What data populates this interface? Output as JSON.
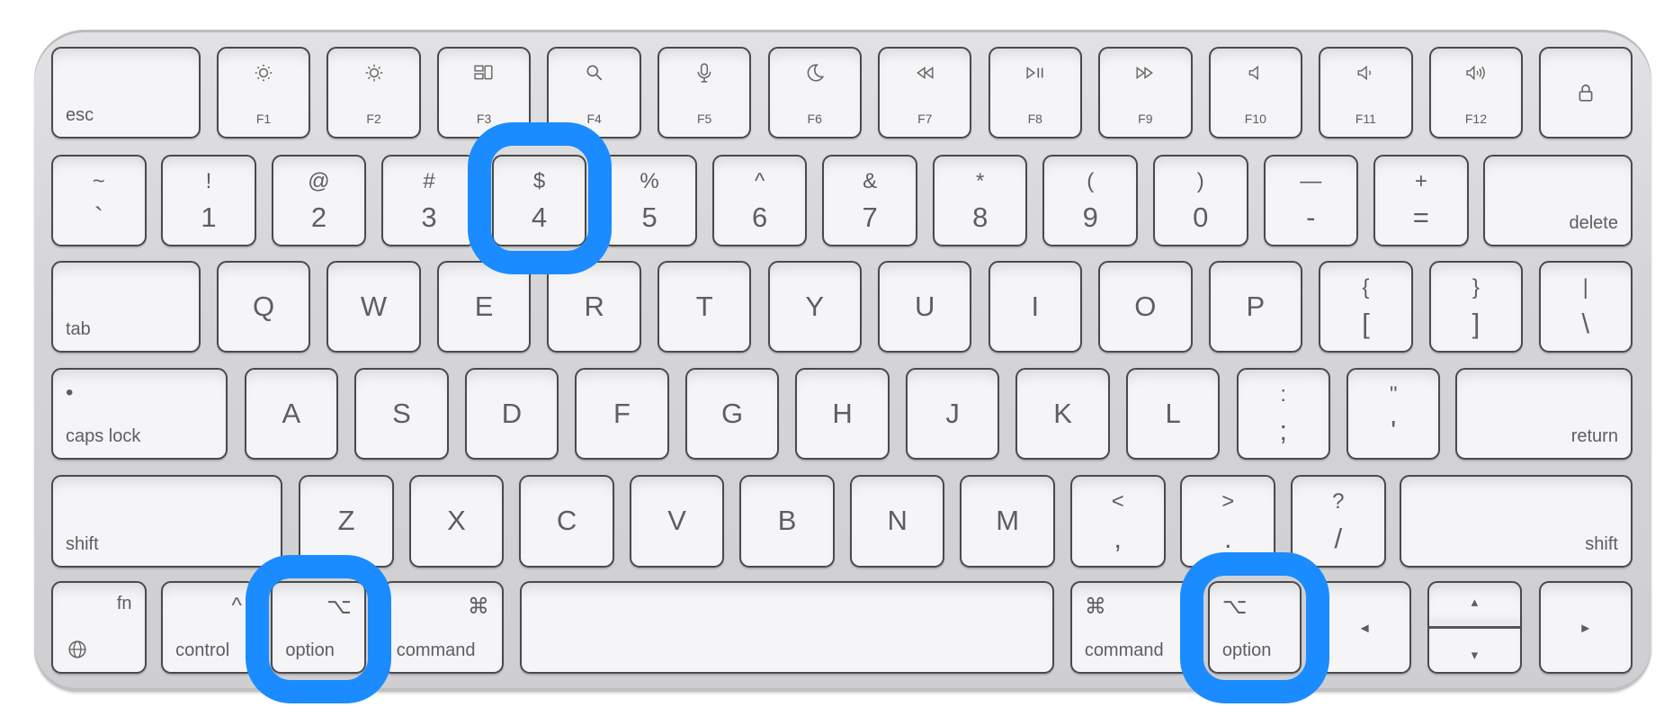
{
  "highlight_color": "#1a8cff",
  "highlighted_keys": [
    "4",
    "option (left)",
    "option (right)"
  ],
  "rows": [
    {
      "keys": [
        {
          "bl": "esc"
        },
        {
          "icon": "brightness-down-icon",
          "fn": "F1"
        },
        {
          "icon": "brightness-up-icon",
          "fn": "F2"
        },
        {
          "icon": "mission-control-icon",
          "fn": "F3"
        },
        {
          "icon": "search-icon",
          "fn": "F4"
        },
        {
          "icon": "microphone-icon",
          "fn": "F5"
        },
        {
          "icon": "moon-icon",
          "fn": "F6"
        },
        {
          "icon": "rewind-icon",
          "fn": "F7"
        },
        {
          "icon": "play-pause-icon",
          "fn": "F8"
        },
        {
          "icon": "fast-forward-icon",
          "fn": "F9"
        },
        {
          "icon": "mute-icon",
          "fn": "F10"
        },
        {
          "icon": "volume-down-icon",
          "fn": "F11"
        },
        {
          "icon": "volume-up-icon",
          "fn": "F12"
        },
        {
          "icon": "lock-icon"
        }
      ]
    },
    {
      "keys": [
        {
          "top": "~",
          "bottom": "`"
        },
        {
          "top": "!",
          "bottom": "1"
        },
        {
          "top": "@",
          "bottom": "2"
        },
        {
          "top": "#",
          "bottom": "3"
        },
        {
          "top": "$",
          "bottom": "4"
        },
        {
          "top": "%",
          "bottom": "5"
        },
        {
          "top": "^",
          "bottom": "6"
        },
        {
          "top": "&",
          "bottom": "7"
        },
        {
          "top": "*",
          "bottom": "8"
        },
        {
          "top": "(",
          "bottom": "9"
        },
        {
          "top": ")",
          "bottom": "0"
        },
        {
          "top": "—",
          "bottom": "-"
        },
        {
          "top": "+",
          "bottom": "="
        },
        {
          "br": "delete"
        }
      ]
    },
    {
      "keys": [
        {
          "bl": "tab"
        },
        {
          "c": "Q"
        },
        {
          "c": "W"
        },
        {
          "c": "E"
        },
        {
          "c": "R"
        },
        {
          "c": "T"
        },
        {
          "c": "Y"
        },
        {
          "c": "U"
        },
        {
          "c": "I"
        },
        {
          "c": "O"
        },
        {
          "c": "P"
        },
        {
          "top": "{",
          "bottom": "["
        },
        {
          "top": "}",
          "bottom": "]"
        },
        {
          "top": "|",
          "bottom": "\\"
        }
      ]
    },
    {
      "keys": [
        {
          "tl": "•",
          "bl": "caps lock"
        },
        {
          "c": "A"
        },
        {
          "c": "S"
        },
        {
          "c": "D"
        },
        {
          "c": "F"
        },
        {
          "c": "G"
        },
        {
          "c": "H"
        },
        {
          "c": "J"
        },
        {
          "c": "K"
        },
        {
          "c": "L"
        },
        {
          "top": ":",
          "bottom": ";"
        },
        {
          "top": "\"",
          "bottom": "'"
        },
        {
          "br": "return"
        }
      ]
    },
    {
      "keys": [
        {
          "bl": "shift"
        },
        {
          "c": "Z"
        },
        {
          "c": "X"
        },
        {
          "c": "C"
        },
        {
          "c": "V"
        },
        {
          "c": "B"
        },
        {
          "c": "N"
        },
        {
          "c": "M"
        },
        {
          "top": "<",
          "bottom": ","
        },
        {
          "top": ">",
          "bottom": "."
        },
        {
          "top": "?",
          "bottom": "/"
        },
        {
          "br": "shift"
        }
      ]
    },
    {
      "keys": [
        {
          "tr": "fn",
          "icon": "globe-icon"
        },
        {
          "tr": "^",
          "bl": "control"
        },
        {
          "tr": "⌥",
          "bl": "option"
        },
        {
          "tr": "⌘",
          "bl": "command"
        },
        {},
        {
          "tl": "⌘",
          "bl": "command"
        },
        {
          "tl": "⌥",
          "bl": "option"
        },
        {
          "c": "◂"
        },
        {
          "up": "▴",
          "down": "▾"
        },
        {
          "c": "▸"
        }
      ]
    }
  ]
}
